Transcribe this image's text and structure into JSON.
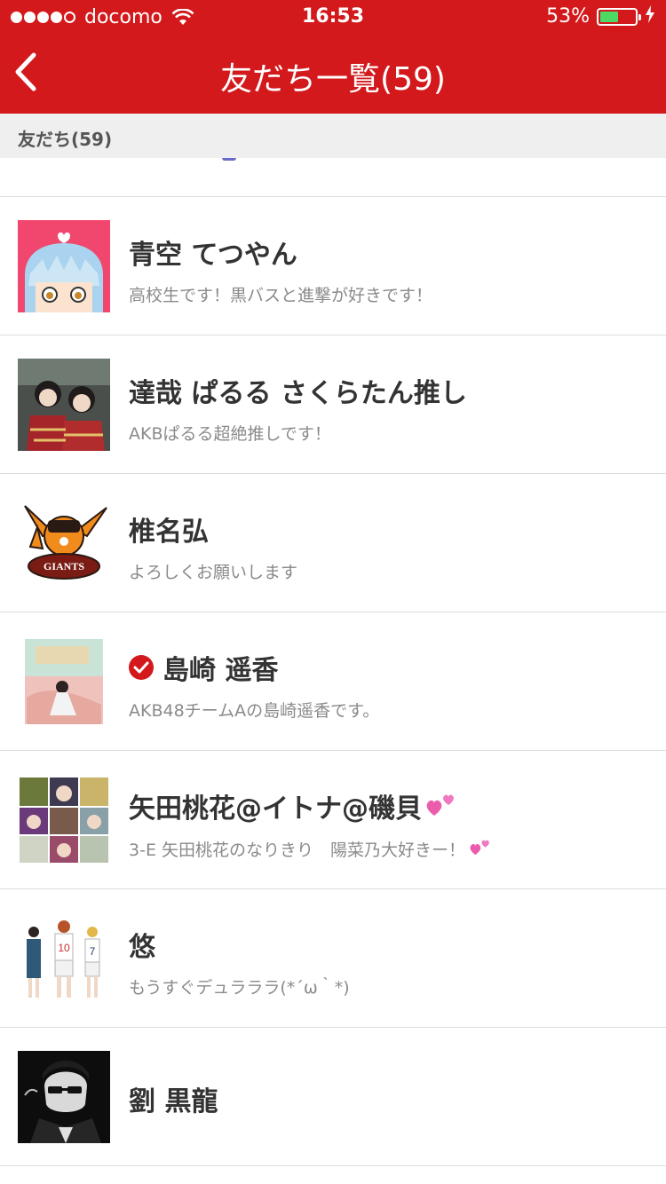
{
  "status_bar": {
    "carrier": "docomo",
    "time": "16:53",
    "battery_percent": "53%",
    "battery_level": 0.53
  },
  "nav": {
    "title": "友だち一覧(59)",
    "back_icon": "chevron-left-icon"
  },
  "section": {
    "title": "友だち(59)"
  },
  "friends": [
    {
      "name": "青空 てつやん",
      "status": "高校生です！黒バスと進撃が好きです！",
      "avatar": "anime-boy-avatar"
    },
    {
      "name": "達哉 ぱるる さくらたん推し",
      "status": "AKBぱるる超絶推しです！",
      "avatar": "photo-avatar"
    },
    {
      "name": "椎名弘",
      "status": "よろしくお願いします",
      "avatar": "giants-mascot-avatar"
    },
    {
      "name": "島崎 遥香",
      "status": "AKB48チームAの島崎遥香です。",
      "avatar": "photo-avatar",
      "verified": true
    },
    {
      "name": "矢田桃花@イトナ@磯貝",
      "status": "3-E 矢田桃花のなりきり　陽菜乃大好きー！",
      "avatar": "anime-collage-avatar",
      "hearts": true
    },
    {
      "name": "悠",
      "status": "もうすぐデュラララ(*´ω｀*)",
      "avatar": "basketball-players-avatar"
    },
    {
      "name": "劉 黒龍",
      "status": "",
      "avatar": "sunglasses-man-avatar"
    }
  ],
  "colors": {
    "header": "#d3191c",
    "section_bg": "#efefef",
    "battery_fill": "#4cd964",
    "verified": "#d3191c"
  }
}
